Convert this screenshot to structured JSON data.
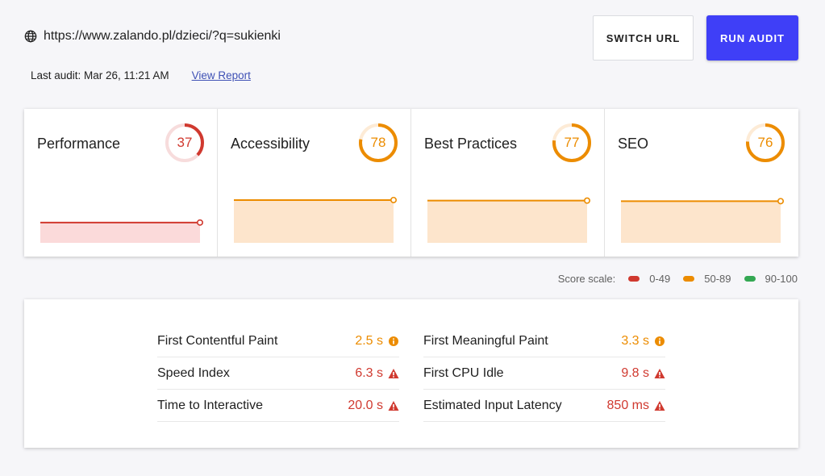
{
  "header": {
    "url": "https://www.zalando.pl/dzieci/?q=sukienki",
    "last_audit": "Last audit: Mar 26, 11:21 AM",
    "view_report": "View Report",
    "switch_url": "SWITCH URL",
    "run_audit": "RUN AUDIT"
  },
  "colors": {
    "fail": "#d0392f",
    "average": "#ec8c00",
    "pass": "#34a853",
    "primary": "#3f3ff7"
  },
  "categories": [
    {
      "title": "Performance",
      "score": 37,
      "status": "fail"
    },
    {
      "title": "Accessibility",
      "score": 78,
      "status": "average"
    },
    {
      "title": "Best Practices",
      "score": 77,
      "status": "average"
    },
    {
      "title": "SEO",
      "score": 76,
      "status": "average"
    }
  ],
  "scale": {
    "label": "Score scale:",
    "ranges": [
      {
        "label": "0-49",
        "status": "fail"
      },
      {
        "label": "50-89",
        "status": "average"
      },
      {
        "label": "90-100",
        "status": "pass"
      }
    ]
  },
  "metrics": {
    "left": [
      {
        "label": "First Contentful Paint",
        "value": "2.5 s",
        "icon": "info-circle-icon"
      },
      {
        "label": "Speed Index",
        "value": "6.3 s",
        "icon": "warning-triangle-icon"
      },
      {
        "label": "Time to Interactive",
        "value": "20.0 s",
        "icon": "warning-triangle-icon"
      }
    ],
    "right": [
      {
        "label": "First Meaningful Paint",
        "value": "3.3 s",
        "icon": "info-circle-icon"
      },
      {
        "label": "First CPU Idle",
        "value": "9.8 s",
        "icon": "warning-triangle-icon"
      },
      {
        "label": "Estimated Input Latency",
        "value": "850 ms",
        "icon": "warning-triangle-icon"
      }
    ]
  }
}
